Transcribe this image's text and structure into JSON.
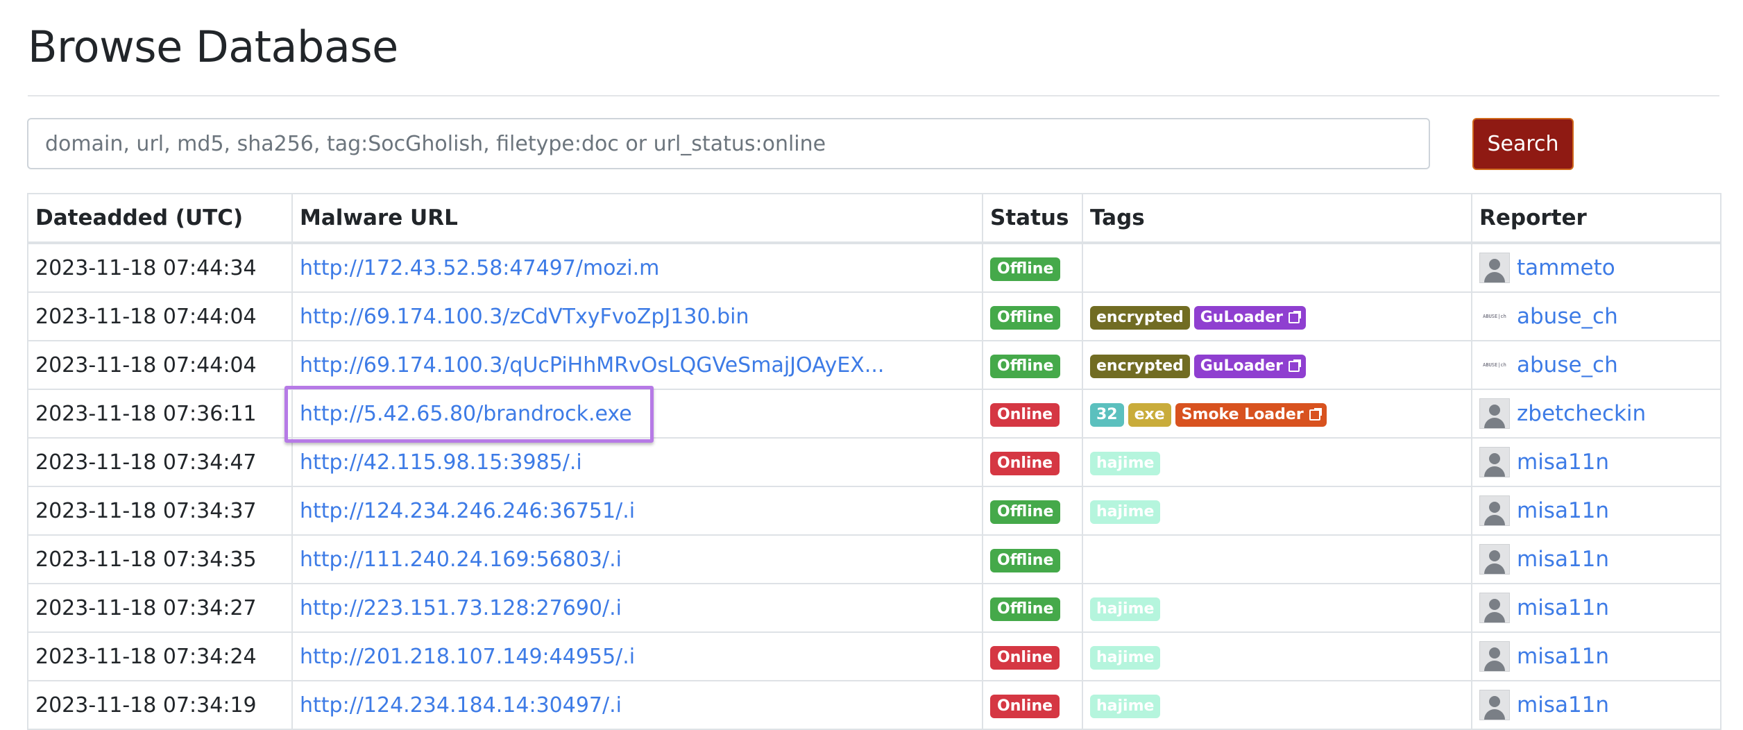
{
  "page": {
    "title": "Browse Database"
  },
  "search": {
    "placeholder": "domain, url, md5, sha256, tag:SocGholish, filetype:doc or url_status:online",
    "value": "",
    "button_label": "Search"
  },
  "table": {
    "headers": {
      "date": "Dateadded (UTC)",
      "url": "Malware URL",
      "status": "Status",
      "tags": "Tags",
      "reporter": "Reporter"
    },
    "rows": [
      {
        "date": "2023-11-18 07:44:34",
        "url": "http://172.43.52.58:47497/mozi.m",
        "status": "Offline",
        "reporter": "tammeto"
      },
      {
        "date": "2023-11-18 07:44:04",
        "url": "http://69.174.100.3/zCdVTxyFvoZpJ130.bin",
        "status": "Offline",
        "tag1": "encrypted",
        "tag2": "GuLoader",
        "reporter": "abuse_ch",
        "reporter_logo": "ABUSE|ch"
      },
      {
        "date": "2023-11-18 07:44:04",
        "url": "http://69.174.100.3/qUcPiHhMRvOsLQGVeSmajJOAyEX...",
        "status": "Offline",
        "tag1": "encrypted",
        "tag2": "GuLoader",
        "reporter": "abuse_ch",
        "reporter_logo": "ABUSE|ch"
      },
      {
        "date": "2023-11-18 07:36:11",
        "url": "http://5.42.65.80/brandrock.exe",
        "status": "Online",
        "tag1": "32",
        "tag2": "exe",
        "tag3": "Smoke Loader",
        "reporter": "zbetcheckin"
      },
      {
        "date": "2023-11-18 07:34:47",
        "url": "http://42.115.98.15:3985/.i",
        "status": "Online",
        "tag1": "hajime",
        "reporter": "misa11n"
      },
      {
        "date": "2023-11-18 07:34:37",
        "url": "http://124.234.246.246:36751/.i",
        "status": "Offline",
        "tag1": "hajime",
        "reporter": "misa11n"
      },
      {
        "date": "2023-11-18 07:34:35",
        "url": "http://111.240.24.169:56803/.i",
        "status": "Offline",
        "reporter": "misa11n"
      },
      {
        "date": "2023-11-18 07:34:27",
        "url": "http://223.151.73.128:27690/.i",
        "status": "Offline",
        "tag1": "hajime",
        "reporter": "misa11n"
      },
      {
        "date": "2023-11-18 07:34:24",
        "url": "http://201.218.107.149:44955/.i",
        "status": "Online",
        "tag1": "hajime",
        "reporter": "misa11n"
      },
      {
        "date": "2023-11-18 07:34:19",
        "url": "http://124.234.184.14:30497/.i",
        "status": "Online",
        "tag1": "hajime",
        "reporter": "misa11n"
      }
    ]
  },
  "colors": {
    "link": "#3d7be6",
    "search_button": "#8f1a13",
    "status_offline": "#45a94a",
    "status_online": "#d53743",
    "tag_encrypted": "#716c23",
    "tag_guloader": "#8f3fd0",
    "tag_32": "#5bc0be",
    "tag_exe": "#c9ac3b",
    "tag_smoke_loader": "#d8521f",
    "tag_hajime": "#b5f5dd",
    "highlight_box": "#b67ae6"
  },
  "icons": {
    "avatar": "user-avatar-icon",
    "external_link": "external-link-icon"
  }
}
